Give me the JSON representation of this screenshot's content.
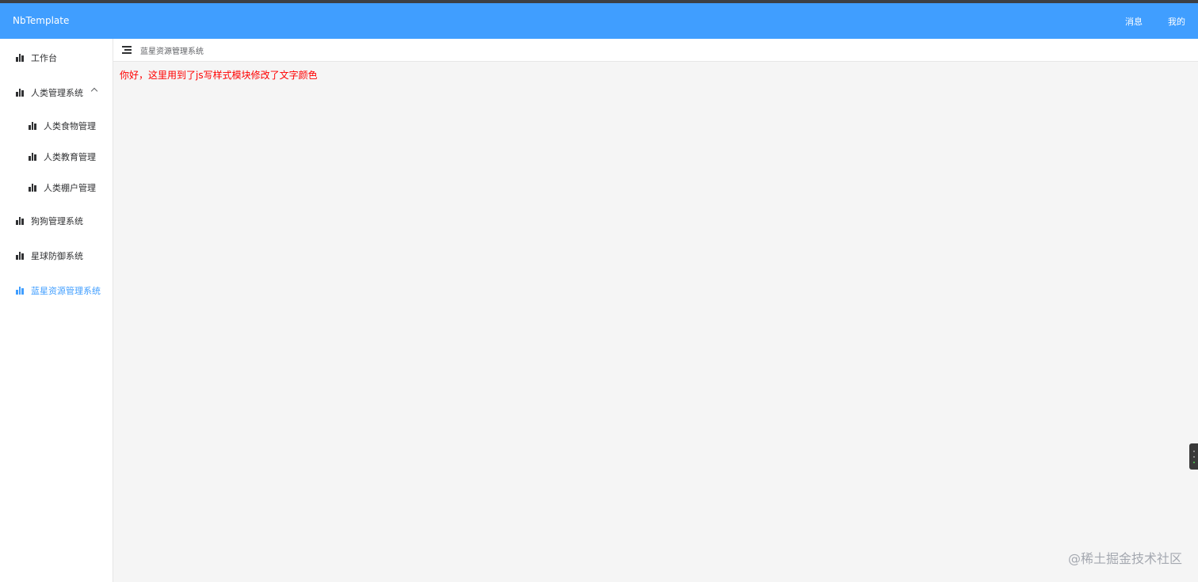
{
  "header": {
    "brand": "NbTemplate",
    "nav": [
      "消息",
      "我的"
    ],
    "bg_color": "#409eff"
  },
  "sidebar": {
    "items": [
      {
        "label": "工作台",
        "icon": "bar-chart-icon"
      },
      {
        "label": "人类管理系统",
        "icon": "bar-chart-icon",
        "expanded": true,
        "children": [
          {
            "label": "人类食物管理",
            "icon": "bar-chart-icon"
          },
          {
            "label": "人类教育管理",
            "icon": "bar-chart-icon"
          },
          {
            "label": "人类棚户管理",
            "icon": "bar-chart-icon"
          }
        ]
      },
      {
        "label": "狗狗管理系统",
        "icon": "bar-chart-icon"
      },
      {
        "label": "星球防御系统",
        "icon": "bar-chart-icon"
      },
      {
        "label": "蓝星资源管理系统",
        "icon": "bar-chart-icon",
        "active": true
      }
    ],
    "active_color": "#409eff"
  },
  "content": {
    "breadcrumb": "蓝星资源管理系统",
    "message": "你好，这里用到了js写样式模块修改了文字颜色",
    "message_color": "#ff0000"
  },
  "watermark": "@稀土掘金技术社区"
}
